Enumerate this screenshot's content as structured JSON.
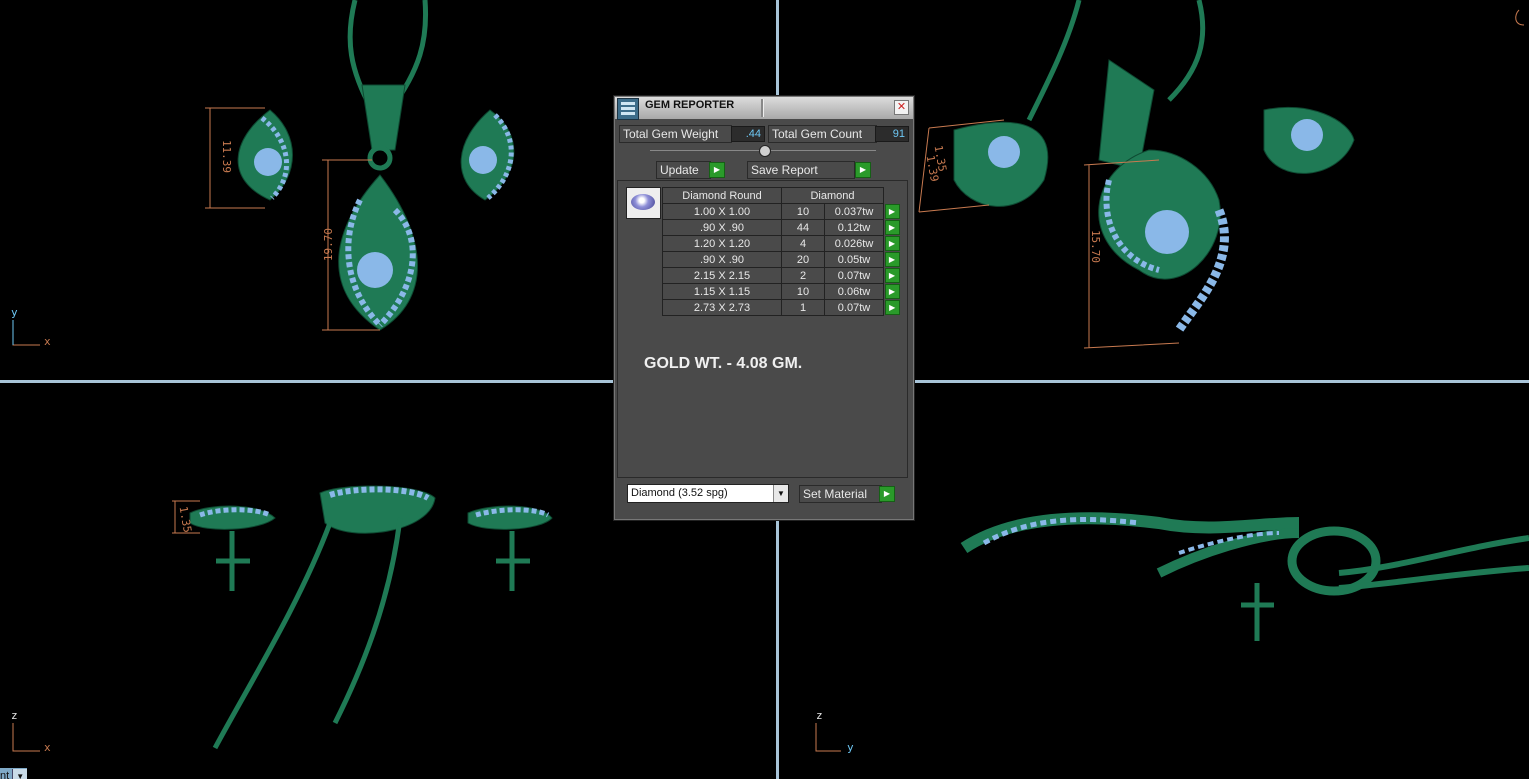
{
  "viewports": {
    "top_left": {
      "axis_v": "y",
      "axis_h": "x",
      "dims": [
        "11.39",
        "19.70"
      ]
    },
    "top_right": {
      "dims": [
        "1.35",
        "1.39",
        "15.70"
      ]
    },
    "bottom_left": {
      "axis_v": "z",
      "axis_h": "x",
      "dims": [
        "1.35"
      ],
      "view_dropdown": "nt"
    },
    "bottom_right": {
      "axis_v": "z",
      "axis_h": "y"
    }
  },
  "dialog": {
    "title": "GEM REPORTER",
    "close": "✕",
    "total_gem_weight_label": "Total Gem Weight",
    "total_gem_weight_value": ".44",
    "total_gem_count_label": "Total Gem Count",
    "total_gem_count_value": "91",
    "update_label": "Update",
    "save_report_label": "Save Report",
    "table": {
      "col1": "Diamond Round",
      "col2": "Diamond",
      "rows": [
        {
          "size": "1.00 X 1.00",
          "count": "10",
          "weight": "0.037tw"
        },
        {
          "size": ".90 X .90",
          "count": "44",
          "weight": "0.12tw"
        },
        {
          "size": "1.20 X 1.20",
          "count": "4",
          "weight": "0.026tw"
        },
        {
          "size": ".90 X .90",
          "count": "20",
          "weight": "0.05tw"
        },
        {
          "size": "2.15 X 2.15",
          "count": "2",
          "weight": "0.07tw"
        },
        {
          "size": "1.15 X 1.15",
          "count": "10",
          "weight": "0.06tw"
        },
        {
          "size": "2.73 X 2.73",
          "count": "1",
          "weight": "0.07tw"
        }
      ]
    },
    "note": "GOLD WT. - 4.08 GM.",
    "material_select": "Diamond     (3.52 spg)",
    "set_material_label": "Set Material",
    "go_glyph": "▶"
  },
  "colors": {
    "metal": "#1f7a55",
    "gems": "#8ab8e8",
    "dimension": "#c87a50",
    "divider": "#a8c4d8"
  }
}
